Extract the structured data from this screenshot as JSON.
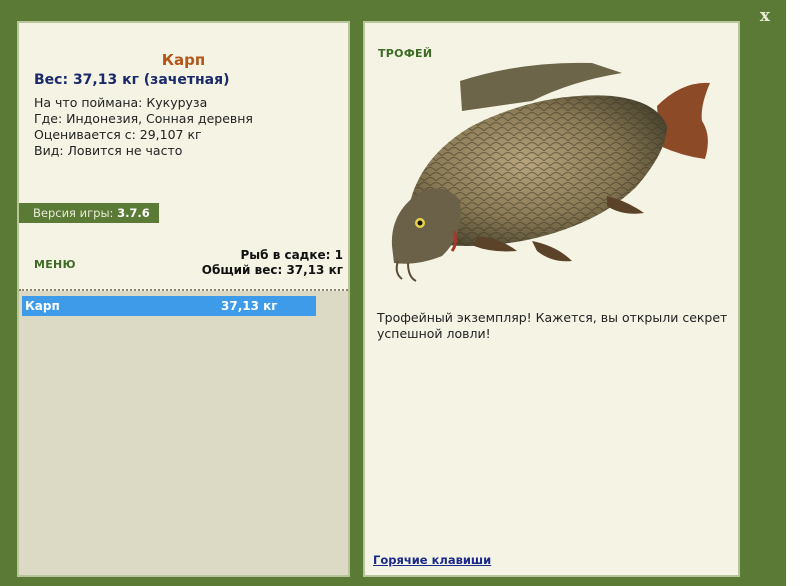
{
  "window": {
    "close_label": "x"
  },
  "fish": {
    "name": "Карп",
    "weight_line": "Вес: 37,13 кг (зачетная)",
    "bait_line": "На что поймана: Кукуруза",
    "location_line": "Где: Индонезия, Сонная деревня",
    "value_line": "Оценивается с: 29,107 кг",
    "rarity_line": "Вид: Ловится не часто"
  },
  "version": {
    "label": "Версия игры:",
    "value": "3.7.6"
  },
  "menu": {
    "label": "МЕНЮ"
  },
  "cage": {
    "count_line": "Рыб в садке: 1",
    "weight_line": "Общий вес: 37,13 кг"
  },
  "catch_list": [
    {
      "name": "Карп",
      "weight": "37,13 кг",
      "selected": true
    }
  ],
  "trophy": {
    "label": "ТРОФЕЙ",
    "image": "carp-trophy-photo",
    "text": "Трофейный экземпляр! Кажется, вы открыли секрет успешной ловли!"
  },
  "hotkeys": {
    "label": "Горячие клавиши"
  }
}
